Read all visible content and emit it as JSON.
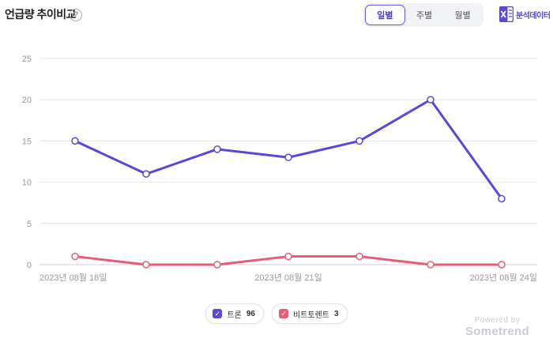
{
  "header": {
    "title": "언급량 추이비교",
    "help_glyph": "?"
  },
  "period_tabs": [
    {
      "label": "일별",
      "active": true
    },
    {
      "label": "주별",
      "active": false
    },
    {
      "label": "월별",
      "active": false
    }
  ],
  "export": {
    "label": "분석데이터",
    "icon": "excel-icon"
  },
  "colors": {
    "series1": "#5b48d9",
    "series2": "#e85d75",
    "accent": "#6b5ce7"
  },
  "chart_data": {
    "type": "line",
    "x": [
      "2023-08-18",
      "2023-08-19",
      "2023-08-20",
      "2023-08-21",
      "2023-08-22",
      "2023-08-23",
      "2023-08-24"
    ],
    "x_tick_labels": [
      {
        "index": 0,
        "label": "2023년 08월 18일"
      },
      {
        "index": 3,
        "label": "2023년 08월 21일"
      },
      {
        "index": 6,
        "label": "2023년 08월 24일"
      }
    ],
    "y_ticks": [
      0,
      5,
      10,
      15,
      20,
      25
    ],
    "ylim": [
      0,
      25
    ],
    "grid": true,
    "series": [
      {
        "name": "트론",
        "values": [
          15,
          11,
          14,
          13,
          15,
          20,
          8
        ],
        "color": "#5b48d9"
      },
      {
        "name": "비트토렌트",
        "values": [
          1,
          0,
          0,
          1,
          1,
          0,
          0
        ],
        "color": "#e85d75"
      }
    ]
  },
  "legend": [
    {
      "label": "트론",
      "count": "96",
      "color": "#5b48d9",
      "checked": true
    },
    {
      "label": "비트토렌트",
      "count": "3",
      "color": "#e85d75",
      "checked": true
    }
  ],
  "footer": {
    "powered_by": "Powered by",
    "brand": "Sometrend"
  }
}
